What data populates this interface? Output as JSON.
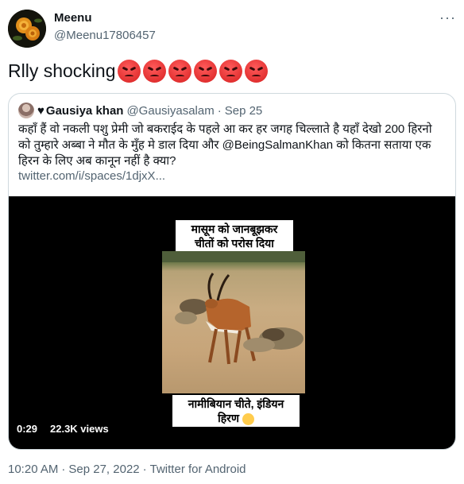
{
  "author": {
    "display_name": "Meenu",
    "handle": "@Meenu17806457"
  },
  "more_label": "···",
  "tweet": {
    "text": "Rlly shocking",
    "emoji_count": 6,
    "emoji_name": "angry-face-icon"
  },
  "quote": {
    "name": "Gausiya khan",
    "handle": "@Gausiyasalam",
    "separator": "·",
    "date": "Sep 25",
    "text": "कहाँ हैं वो नकली पशु प्रेमी जो बकराईद के पहले आ कर हर जगह चिल्लाते है यहाँ देखो 200 हिरनो को तुम्हारे अब्बा ने मौत के मुँह मे डाल दिया और @BeingSalmanKhan को कितना सताया एक हिरन के लिए अब कानून नहीं है क्या?",
    "link": "twitter.com/i/spaces/1djxX..."
  },
  "media": {
    "caption_top": "मासूम को जानबूझकर चीतों को परोस दिया",
    "caption_bottom": "नामीबियान चीते, इंडियन हिरण",
    "duration": "0:29",
    "views": "22.3K views"
  },
  "meta": {
    "time": "10:20 AM",
    "separator": "·",
    "date": "Sep 27, 2022",
    "source": "Twitter for Android"
  },
  "colors": {
    "text": "#0f1419",
    "secondary": "#536471",
    "border": "#cfd9de"
  }
}
